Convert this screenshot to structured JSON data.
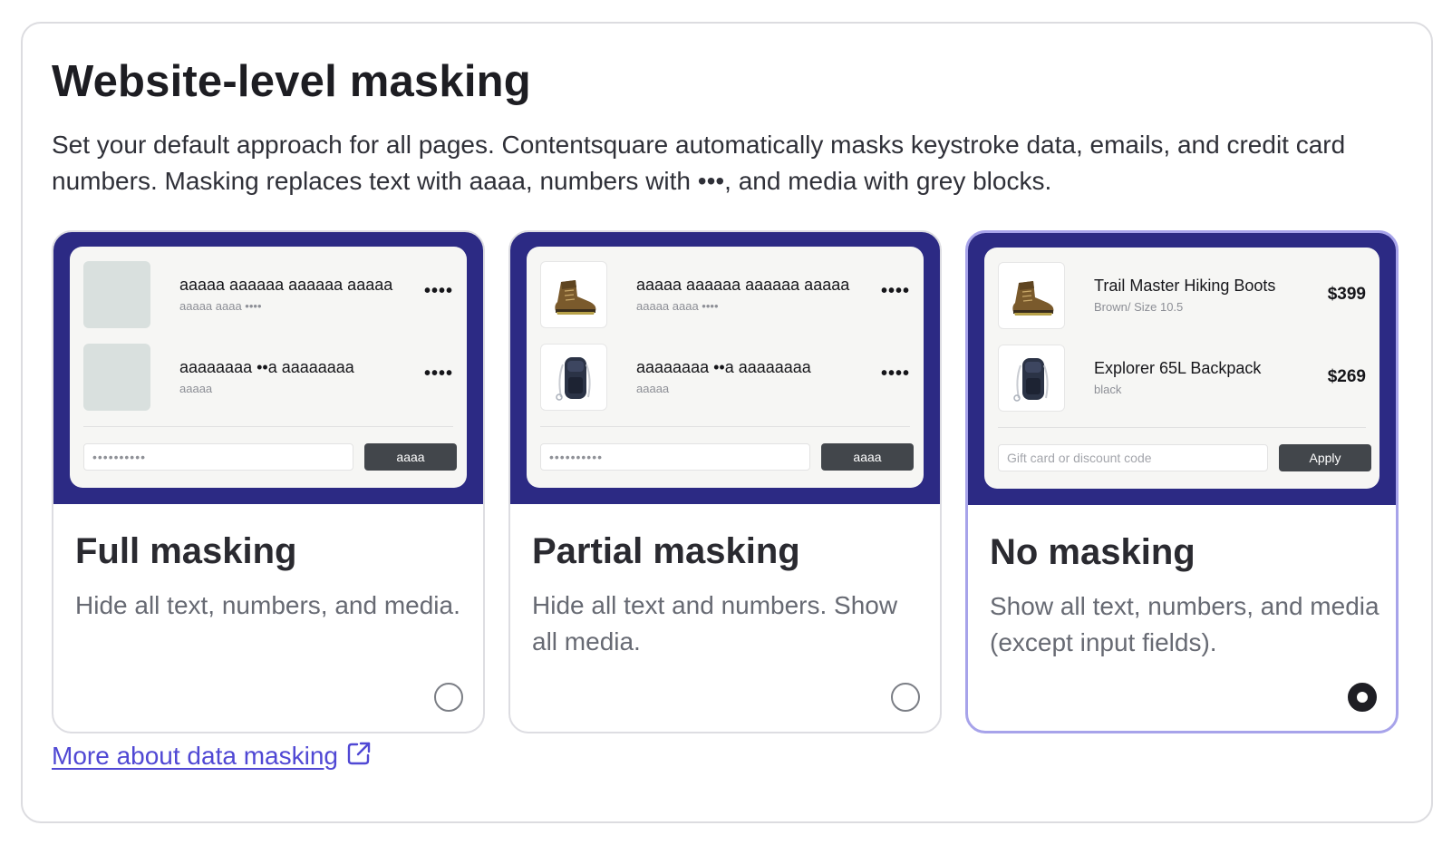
{
  "header": {
    "title": "Website-level masking",
    "description": "Set your default approach for all pages. Contentsquare automatically masks keystroke data, emails, and credit card numbers. Masking replaces text with aaaa, numbers with •••, and media with grey blocks."
  },
  "options": [
    {
      "title": "Full masking",
      "description": "Hide all text, numbers, and media.",
      "selected": false,
      "preview": {
        "items": [
          {
            "name": "aaaaa aaaaaa aaaaaa aaaaa",
            "sub": "aaaaa aaaa ••••",
            "price": "••••",
            "image": "masked"
          },
          {
            "name": "aaaaaaaa ••a aaaaaaaa",
            "sub": "aaaaa",
            "price": "••••",
            "image": "masked"
          }
        ],
        "input_text": "••••••••••",
        "button_label": "aaaa"
      }
    },
    {
      "title": "Partial masking",
      "description": "Hide all text and numbers. Show all media.",
      "selected": false,
      "preview": {
        "items": [
          {
            "name": "aaaaa aaaaaa aaaaaa aaaaa",
            "sub": "aaaaa aaaa ••••",
            "price": "••••",
            "image": "boot-image"
          },
          {
            "name": "aaaaaaaa ••a aaaaaaaa",
            "sub": "aaaaa",
            "price": "••••",
            "image": "backpack-image"
          }
        ],
        "input_text": "••••••••••",
        "button_label": "aaaa"
      }
    },
    {
      "title": "No masking",
      "description": "Show all text, numbers, and media (except input fields).",
      "selected": true,
      "preview": {
        "items": [
          {
            "name": "Trail Master Hiking Boots",
            "sub": "Brown/ Size 10.5",
            "price": "$399",
            "image": "boot-image"
          },
          {
            "name": "Explorer 65L Backpack",
            "sub": "black",
            "price": "$269",
            "image": "backpack-image"
          }
        ],
        "input_placeholder": "Gift card or discount code",
        "button_label": "Apply"
      }
    }
  ],
  "footer": {
    "link_label": "More about data masking",
    "link_icon": "external-link-icon"
  },
  "colors": {
    "preview_bg": "#2c2a84",
    "selected_border": "#a7a3ea",
    "link": "#5048d4"
  }
}
